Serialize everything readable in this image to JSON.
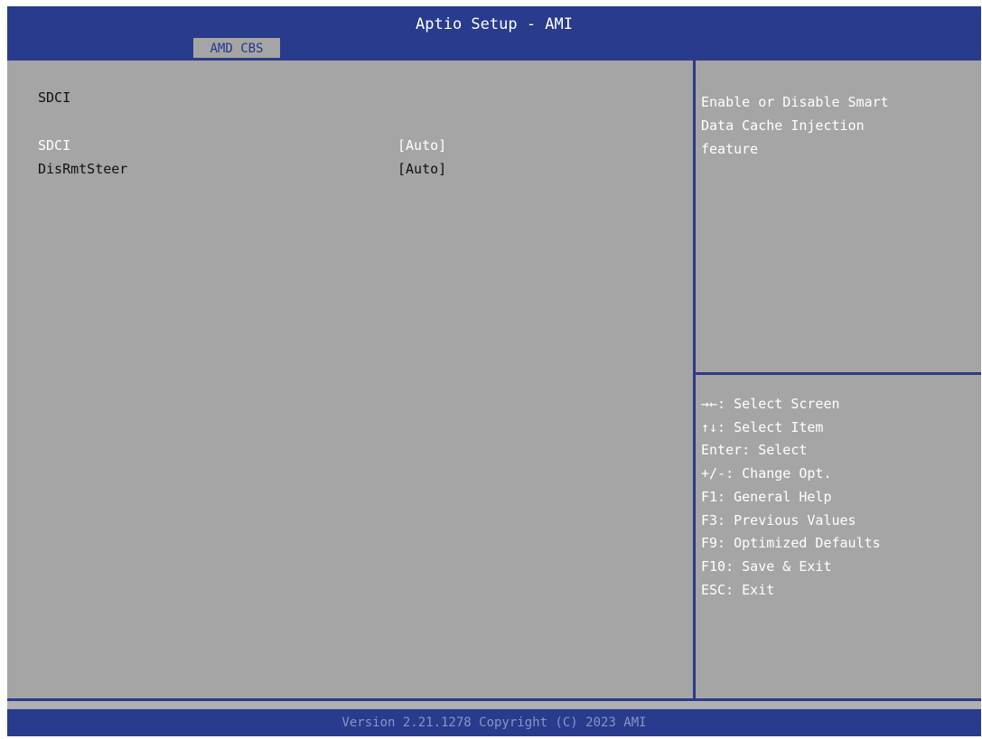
{
  "app": {
    "title": "Aptio Setup - AMI"
  },
  "tabs": [
    {
      "label": "AMD CBS"
    }
  ],
  "main": {
    "section_title": "SDCI",
    "settings": [
      {
        "label": "SDCI",
        "value": "[Auto]"
      },
      {
        "label": "DisRmtSteer",
        "value": "[Auto]"
      }
    ]
  },
  "help": {
    "lines": [
      "Enable or Disable Smart",
      "Data Cache Injection",
      "feature"
    ]
  },
  "keys": [
    "→←: Select Screen",
    "↑↓: Select Item",
    "Enter: Select",
    "+/-: Change Opt.",
    "F1: General Help",
    "F3: Previous Values",
    "F9: Optimized Defaults",
    "F10: Save & Exit",
    "ESC: Exit"
  ],
  "footer": {
    "version_text": "Version 2.21.1278 Copyright (C) 2023 AMI"
  },
  "colors": {
    "title_bar": "#283b8c",
    "panel_bg": "#a5a5a5",
    "selected_text": "#ffffff",
    "border": "#2d3a8a"
  }
}
